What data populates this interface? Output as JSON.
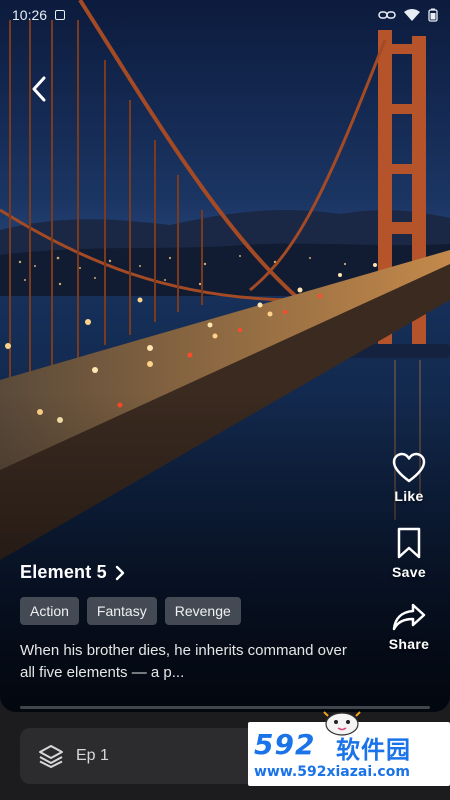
{
  "status": {
    "time": "10:26"
  },
  "title": "Element 5",
  "tags": [
    "Action",
    "Fantasy",
    "Revenge"
  ],
  "description": "When his brother dies, he inherits command over all five elements — a p...",
  "actions": {
    "like": "Like",
    "save": "Save",
    "share": "Share"
  },
  "episode": {
    "label": "Ep 1"
  },
  "progress": 0,
  "watermark": {
    "logo": "592",
    "name": "软件园",
    "url": "www.592xiazai.com"
  },
  "icons": {
    "back": "chevron-left-icon",
    "like": "heart-icon",
    "save": "bookmark-icon",
    "share": "share-arrow-icon",
    "episode": "layers-icon",
    "title": "chevron-right-icon"
  }
}
